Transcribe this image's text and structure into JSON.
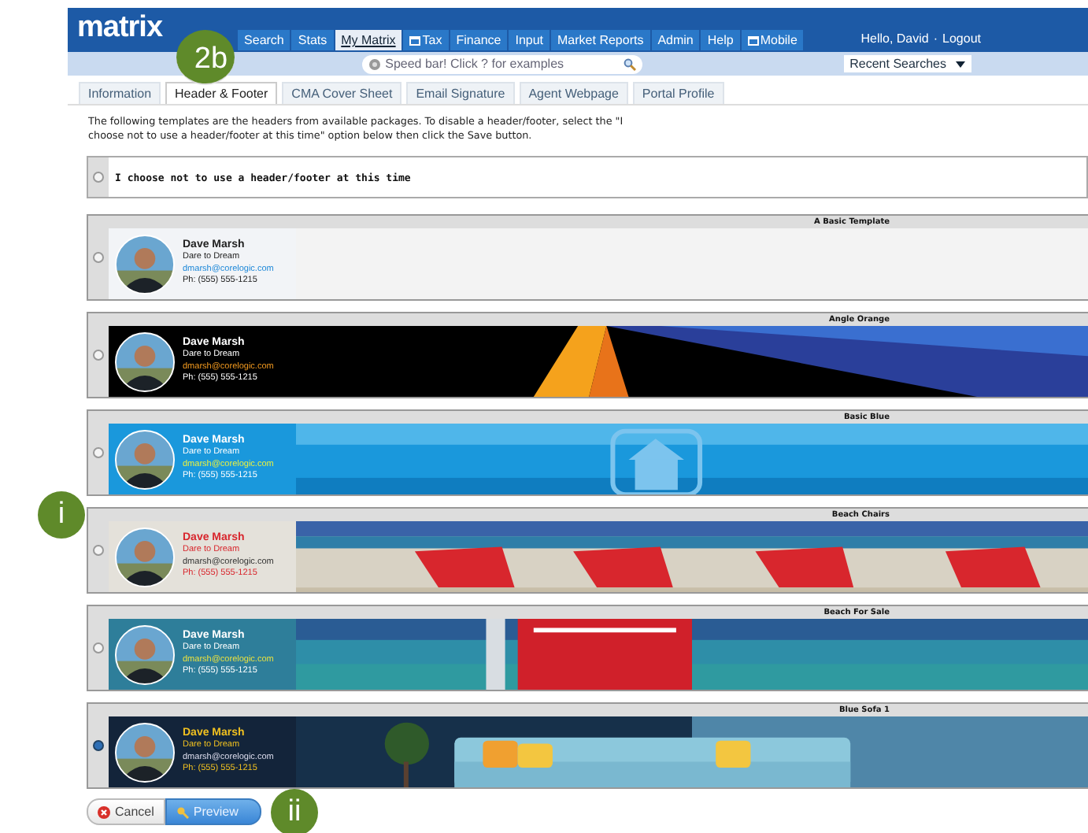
{
  "header": {
    "logo": "matrix",
    "nav": [
      {
        "label": "Search",
        "selected": false,
        "kind": "plain"
      },
      {
        "label": "Stats",
        "selected": false,
        "kind": "plain"
      },
      {
        "label": "My Matrix",
        "selected": true,
        "kind": "plain"
      },
      {
        "label": "Tax",
        "selected": false,
        "kind": "window"
      },
      {
        "label": "Finance",
        "selected": false,
        "kind": "plain"
      },
      {
        "label": "Input",
        "selected": false,
        "kind": "plain"
      },
      {
        "label": "Market Reports",
        "selected": false,
        "kind": "plain"
      },
      {
        "label": "Admin",
        "selected": false,
        "kind": "plain"
      },
      {
        "label": "Help",
        "selected": false,
        "kind": "plain"
      },
      {
        "label": "Mobile",
        "selected": false,
        "kind": "window"
      }
    ],
    "greeting": "Hello, David",
    "separator": "·",
    "logout": "Logout"
  },
  "speed_bar": {
    "placeholder": "Speed bar! Click ? for examples"
  },
  "recent_searches": "Recent Searches",
  "tabs": [
    {
      "label": "Information",
      "selected": false
    },
    {
      "label": "Header & Footer",
      "selected": true
    },
    {
      "label": "CMA Cover Sheet",
      "selected": false
    },
    {
      "label": "Email Signature",
      "selected": false
    },
    {
      "label": "Agent Webpage",
      "selected": false
    },
    {
      "label": "Portal Profile",
      "selected": false
    }
  ],
  "intro": "The following templates are the headers from available packages. To disable a header/footer, select the \"I choose not to use a header/footer at this time\" option below then click the Save button.",
  "opt_out": {
    "label": "I choose not to use a header/footer at this time",
    "selected": false
  },
  "templates": [
    {
      "title": "A Basic Template",
      "kind": "basic",
      "selected": false,
      "name": "Dave Marsh",
      "tagline": "Dare to Dream",
      "email": "dmarsh@corelogic.com",
      "phone": "Ph: (555) 555-1215"
    },
    {
      "title": "Angle Orange",
      "kind": "angle",
      "selected": false,
      "name": "Dave Marsh",
      "tagline": "Dare to Dream",
      "email": "dmarsh@corelogic.com",
      "phone": "Ph: (555) 555-1215"
    },
    {
      "title": "Basic Blue",
      "kind": "blue",
      "selected": false,
      "name": "Dave Marsh",
      "tagline": "Dare to Dream",
      "email": "dmarsh@corelogic.com",
      "phone": "Ph: (555) 555-1215"
    },
    {
      "title": "Beach Chairs",
      "kind": "chairs",
      "selected": false,
      "name": "Dave Marsh",
      "tagline": "Dare to Dream",
      "email": "dmarsh@corelogic.com",
      "phone": "Ph: (555) 555-1215"
    },
    {
      "title": "Beach For Sale",
      "kind": "forsale",
      "selected": false,
      "name": "Dave Marsh",
      "tagline": "Dare to Dream",
      "email": "dmarsh@corelogic.com",
      "phone": "Ph: (555) 555-1215"
    },
    {
      "title": "Blue Sofa 1",
      "kind": "sofa",
      "selected": true,
      "name": "Dave Marsh",
      "tagline": "Dare to Dream",
      "email": "dmarsh@corelogic.com",
      "phone": "Ph: (555) 555-1215"
    }
  ],
  "buttons": [
    {
      "label": "Cancel",
      "kind": "cancel"
    },
    {
      "label": "Preview",
      "kind": "preview"
    }
  ],
  "callouts": [
    {
      "label": "2b",
      "kind": "tabs"
    },
    {
      "label": "i",
      "kind": "templates"
    },
    {
      "label": "ii",
      "kind": "buttons"
    }
  ]
}
